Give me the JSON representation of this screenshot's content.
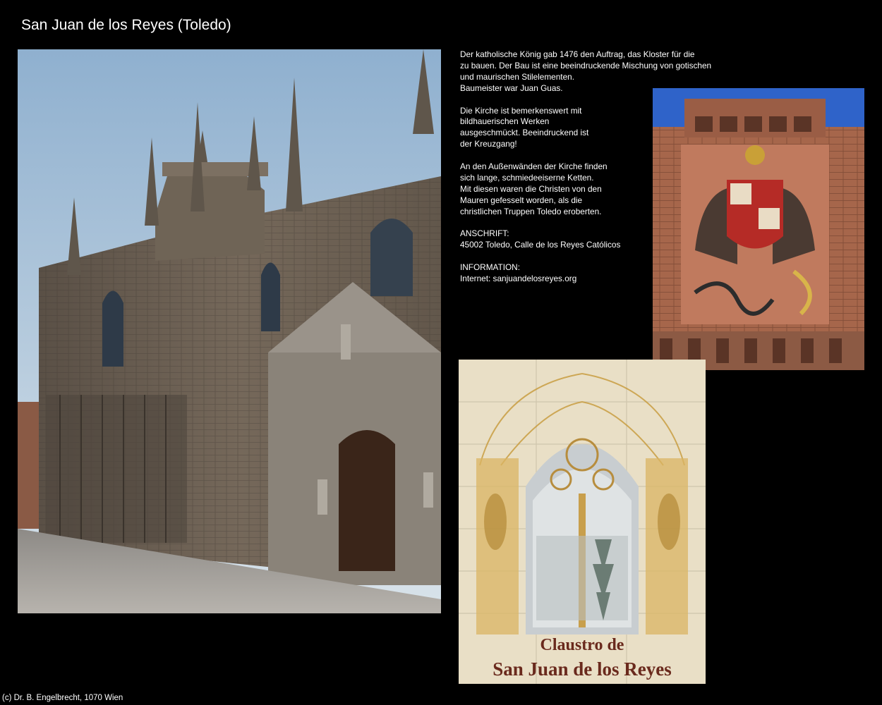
{
  "page": {
    "title": "San Juan de los Reyes (Toledo)",
    "footer": "(c) Dr. B. Engelbrecht, 1070 Wien"
  },
  "text": {
    "p1": [
      "Der katholische König gab 1476 den Auftrag, das Kloster für die",
      "zu bauen. Der Bau ist eine beeindruckende Mischung von gotischen",
      "und maurischen Stilelementen.",
      "Baumeister war Juan Guas."
    ],
    "p2": [
      "Die Kirche ist bemerkenswert mit",
      "bildhauerischen Werken",
      "ausgeschmückt. Beeindruckend ist",
      "der Kreuzgang!"
    ],
    "p3": [
      "An den Außenwänden der Kirche finden",
      "sich lange, schmiedeeiserne Ketten.",
      "Mit diesen waren die Christen von den",
      "Mauren gefesselt worden, als die",
      "christlichen Truppen Toledo eroberten."
    ],
    "p4": [
      "ANSCHRIFT:",
      "45002 Toledo, Calle de los Reyes Católicos"
    ],
    "p5": [
      "INFORMATION:",
      "Internet: sanjuandelosreyes.org"
    ]
  },
  "tile_caption": {
    "line1": "Claustro de",
    "line2": "San Juan de los Reyes"
  },
  "colors": {
    "background": "#000000",
    "text": "#ffffff",
    "sky": "#9cb6cf",
    "stone": "#6e6152",
    "brick": "#a5644a",
    "tile": "#e9dfc6"
  }
}
